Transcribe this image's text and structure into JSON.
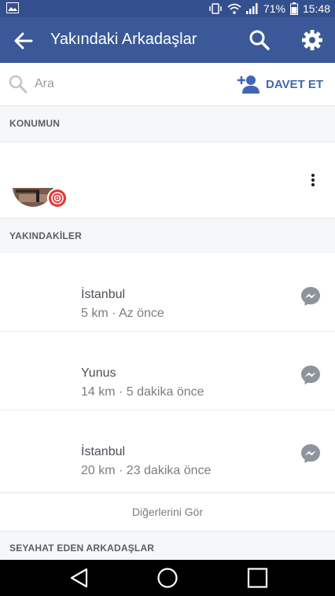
{
  "status_bar": {
    "battery": "71%",
    "time": "15:48"
  },
  "app_bar": {
    "title": "Yakındaki Arkadaşlar"
  },
  "search": {
    "placeholder": "Ara",
    "value": "",
    "invite_label": "DAVET ET"
  },
  "sections": {
    "my_location": "KONUMUN",
    "nearby": "YAKINDAKİLER",
    "traveling": "SEYAHAT EDEN ARKADAŞLAR"
  },
  "nearby_friends": [
    {
      "name": "İstanbul",
      "meta": "5 km · Az önce"
    },
    {
      "name": "Yunus",
      "meta": "14 km · 5 dakika önce"
    },
    {
      "name": "İstanbul",
      "meta": "20 km · 23 dakika önce"
    }
  ],
  "see_all_label": "Diğerlerini Gör",
  "colors": {
    "header": "#3b5998",
    "status_bar": "#334f8d",
    "accent": "#4267b2",
    "badge": "#e23b3b"
  },
  "icons": {
    "back": "arrow-left-icon",
    "search": "search-icon",
    "settings": "gear-icon",
    "invite": "add-person-icon",
    "message": "messenger-icon",
    "more": "more-vertical-icon",
    "location_badge": "target-icon"
  }
}
